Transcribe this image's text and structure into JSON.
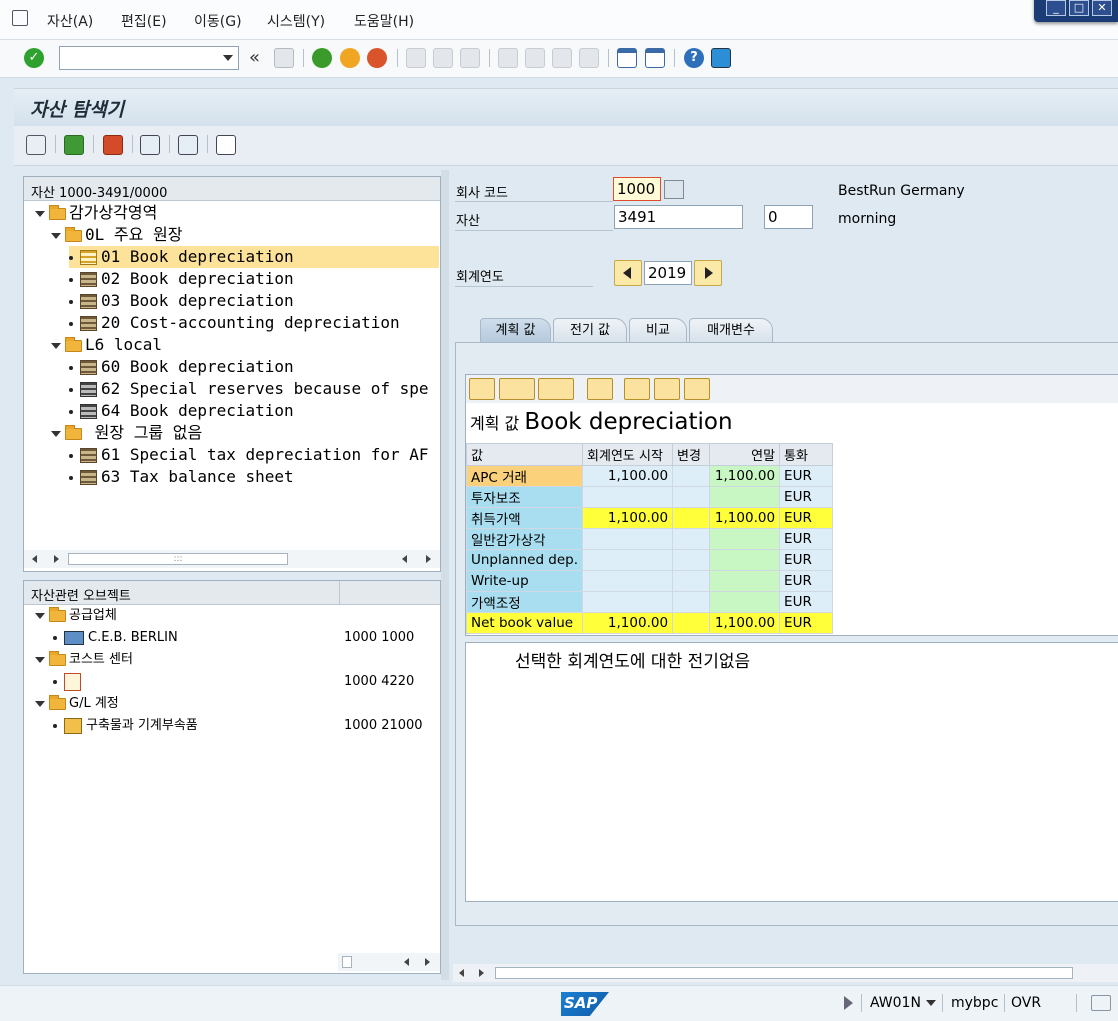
{
  "menu": {
    "items": [
      {
        "label": "자산(A)"
      },
      {
        "label": "편집(E)"
      },
      {
        "label": "이동(G)"
      },
      {
        "label": "시스템(Y)"
      },
      {
        "label": "도움말(H)"
      }
    ]
  },
  "toolbar": {
    "command_value": "",
    "back_glyph": "«"
  },
  "title": "자산 탐색기",
  "tree": {
    "header": "자산 1000-3491/0000",
    "rows": [
      {
        "label": "감가상각영역"
      },
      {
        "label": "0L 주요 원장"
      },
      {
        "label": "01 Book depreciation"
      },
      {
        "label": "02 Book depreciation"
      },
      {
        "label": "03 Book depreciation"
      },
      {
        "label": "20 Cost-accounting depreciation"
      },
      {
        "label": "L6 local"
      },
      {
        "label": "60 Book depreciation"
      },
      {
        "label": "62 Special reserves because of spe"
      },
      {
        "label": "64 Book depreciation"
      },
      {
        "label": " 원장 그룹 없음"
      },
      {
        "label": "61 Special tax depreciation for AF"
      },
      {
        "label": "63 Tax balance sheet"
      }
    ],
    "scroll_grip": ":::"
  },
  "objects": {
    "header": "자산관련 오브젝트",
    "rows": [
      {
        "label": "공급업체",
        "value": ""
      },
      {
        "label": "C.E.B. BERLIN",
        "value": "1000 1000"
      },
      {
        "label": "코스트 센터",
        "value": ""
      },
      {
        "label": "",
        "value": "1000 4220"
      },
      {
        "label": "G/L 계정",
        "value": ""
      },
      {
        "label": "구축물과 기계부속품",
        "value": "1000 21000"
      }
    ]
  },
  "header_fields": {
    "company_code_label": "회사 코드",
    "company_code": "1000",
    "company_name": "BestRun Germany",
    "asset_label": "자산",
    "asset_number": "3491",
    "asset_sub": "0",
    "asset_desc": "morning",
    "fiscal_year_label": "회계연도",
    "fiscal_year": "2019"
  },
  "tabs": [
    {
      "label": "계획 값"
    },
    {
      "label": "전기 값"
    },
    {
      "label": "비교"
    },
    {
      "label": "매개변수"
    }
  ],
  "grid": {
    "title_prefix": "계획 값",
    "title_main": "Book depreciation",
    "columns": [
      "값",
      "회계연도 시작",
      "변경",
      "연말",
      "통화"
    ],
    "rows": [
      {
        "key": "APC 거래",
        "start": "1,100.00",
        "change": "",
        "end": "1,100.00",
        "cur": "EUR"
      },
      {
        "key": "투자보조",
        "start": "",
        "change": "",
        "end": "",
        "cur": "EUR"
      },
      {
        "key": "취득가액",
        "start": "1,100.00",
        "change": "",
        "end": "1,100.00",
        "cur": "EUR"
      },
      {
        "key": "일반감가상각",
        "start": "",
        "change": "",
        "end": "",
        "cur": "EUR"
      },
      {
        "key": "Unplanned dep.",
        "start": "",
        "change": "",
        "end": "",
        "cur": "EUR"
      },
      {
        "key": "Write-up",
        "start": "",
        "change": "",
        "end": "",
        "cur": "EUR"
      },
      {
        "key": "가액조정",
        "start": "",
        "change": "",
        "end": "",
        "cur": "EUR"
      },
      {
        "key": "Net book value",
        "start": "1,100.00",
        "change": "",
        "end": "1,100.00",
        "cur": "EUR"
      }
    ]
  },
  "message": "선택한 회계연도에 대한 전기없음",
  "status": {
    "logo": "SAP",
    "transaction": "AW01N",
    "system": "mybpc",
    "mode": "OVR"
  },
  "colors": {
    "accent": "#1c3c76",
    "highlight": "#fde29a",
    "yellow": "#ffff3a",
    "green": "#c9f7c3",
    "blue": "#a9def0"
  }
}
